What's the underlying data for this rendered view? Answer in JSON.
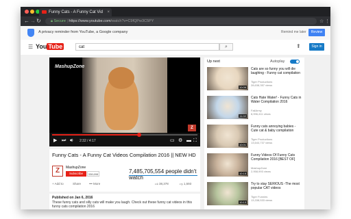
{
  "browser": {
    "tab_title": "Funny Cats - A Funny Cat Vid",
    "tab_close": "×",
    "url_secure": "Secure",
    "url_host": "https://www.youtube.com",
    "url_path": "/watch?v=C9fQPw3C5PY"
  },
  "notice": {
    "text": "A privacy reminder from YouTube, a Google company",
    "remind_later": "Remind me later",
    "review": "Review"
  },
  "masthead": {
    "logo_you": "You",
    "logo_tube": "Tube",
    "search_value": "cat",
    "signin": "Sign in"
  },
  "player": {
    "channel_watermark": "MashupZone",
    "badge": "Z",
    "time": "2:32 / 4:17",
    "progress": 0.6
  },
  "video": {
    "title": "Funny Cats - A Funny Cat Videos Compilation 2016 || NEW HD",
    "channel": "MashupZone",
    "channel_logo": "Z",
    "subscribe": "Subscribe",
    "subscriber_count": "338,698",
    "views": "7,485,705,554 people didn't watch",
    "actions": {
      "add": "+ Add to",
      "share": "Share",
      "more": "••• More",
      "likes": "38,378",
      "dislikes": "1,593"
    },
    "published": "Published on Jan 6, 2016",
    "description": "These funny cats and silly cats will make you laugh. Check out these funny cat videos in this funny cats compilation 2016"
  },
  "sidebar": {
    "up_next": "Up next",
    "autoplay": "Autoplay",
    "items": [
      {
        "title": "Cats are so funny you will die laughing - Funny cat compilation",
        "channel": "Tiger Productions",
        "views": "28,638,357 views",
        "duration": "10:06",
        "color": "#e8d7c0"
      },
      {
        "title": "Cats Hate Water! - Funny Cats in Water Compilation 2016",
        "channel": "FailArmy",
        "views": "8,996,411 views",
        "duration": "11:02",
        "color": "#c3d7ea"
      },
      {
        "title": "Funny cats annoying babies - Cute cat & baby compilation",
        "channel": "Tiger Productions",
        "views": "13,644,737 views",
        "duration": "10:01",
        "color": "#d9c9b3"
      },
      {
        "title": "Funny Videos Of Funny Cats Compilation 2016 [BEST OF]",
        "channel": "MashupZone",
        "views": "2,958,993 views",
        "duration": "10:15",
        "color": "#c9b39c"
      },
      {
        "title": "Try to stay SERIOUS -The most popular CAT videos",
        "channel": "Tiger Funnies",
        "views": "13,338,533 views",
        "duration": "10:13",
        "color": "#b7c59e"
      }
    ]
  }
}
